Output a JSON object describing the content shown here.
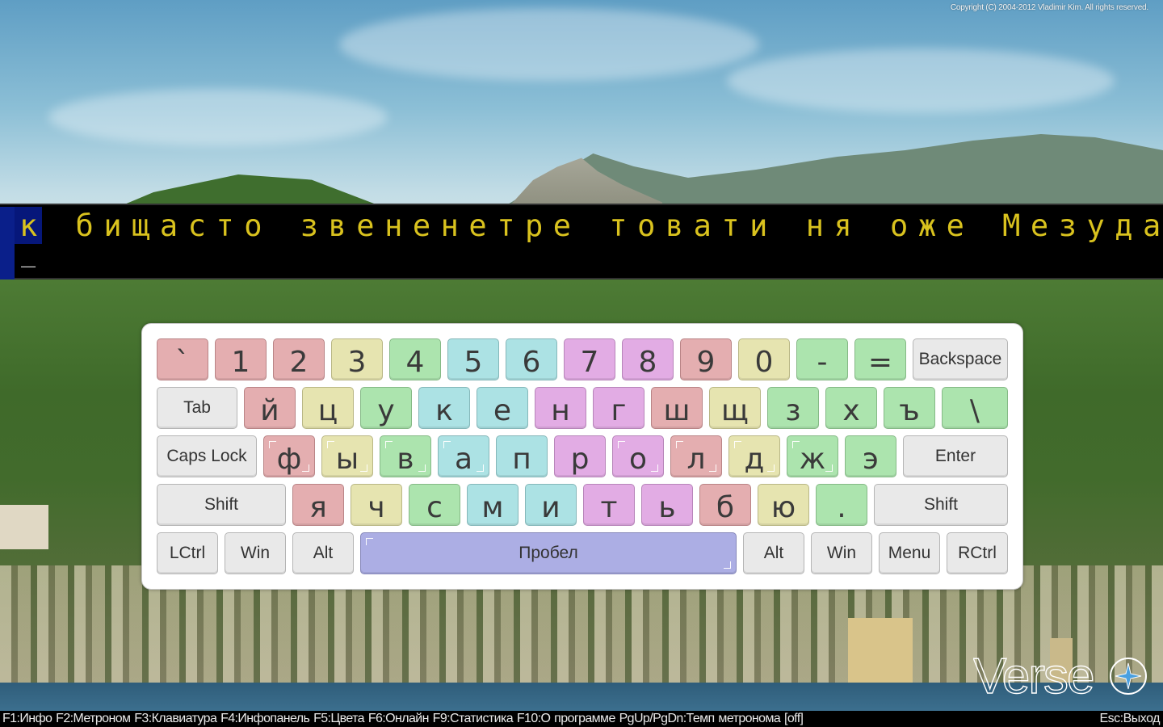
{
  "copyright": "Copyright (C) 2004-2012 Vladimir Kim. All rights reserved.",
  "typing": {
    "target_text": "к бищасто звененетре товати ня оже Мезуда",
    "current_char": "к",
    "input_text": "_"
  },
  "keyboard": {
    "rows": [
      [
        {
          "label": "`",
          "color": "pink"
        },
        {
          "label": "1",
          "color": "pink"
        },
        {
          "label": "2",
          "color": "pink"
        },
        {
          "label": "3",
          "color": "yellow"
        },
        {
          "label": "4",
          "color": "green"
        },
        {
          "label": "5",
          "color": "cyan"
        },
        {
          "label": "6",
          "color": "cyan"
        },
        {
          "label": "7",
          "color": "violet"
        },
        {
          "label": "8",
          "color": "violet"
        },
        {
          "label": "9",
          "color": "pink"
        },
        {
          "label": "0",
          "color": "yellow"
        },
        {
          "label": "-",
          "color": "green"
        },
        {
          "label": "=",
          "color": "green"
        },
        {
          "label": "Backspace",
          "color": "gray"
        }
      ],
      [
        {
          "label": "Tab",
          "color": "gray"
        },
        {
          "label": "й",
          "color": "pink"
        },
        {
          "label": "ц",
          "color": "yellow"
        },
        {
          "label": "у",
          "color": "green"
        },
        {
          "label": "к",
          "color": "cyan"
        },
        {
          "label": "е",
          "color": "cyan"
        },
        {
          "label": "н",
          "color": "violet"
        },
        {
          "label": "г",
          "color": "violet"
        },
        {
          "label": "ш",
          "color": "pink"
        },
        {
          "label": "щ",
          "color": "yellow"
        },
        {
          "label": "з",
          "color": "green"
        },
        {
          "label": "х",
          "color": "green"
        },
        {
          "label": "ъ",
          "color": "green"
        },
        {
          "label": "\\",
          "color": "green"
        }
      ],
      [
        {
          "label": "Caps Lock",
          "color": "gray"
        },
        {
          "label": "ф",
          "color": "pink"
        },
        {
          "label": "ы",
          "color": "yellow"
        },
        {
          "label": "в",
          "color": "green"
        },
        {
          "label": "а",
          "color": "cyan"
        },
        {
          "label": "п",
          "color": "cyan"
        },
        {
          "label": "р",
          "color": "violet"
        },
        {
          "label": "о",
          "color": "violet"
        },
        {
          "label": "л",
          "color": "pink"
        },
        {
          "label": "д",
          "color": "yellow"
        },
        {
          "label": "ж",
          "color": "green"
        },
        {
          "label": "э",
          "color": "green"
        },
        {
          "label": "Enter",
          "color": "gray"
        }
      ],
      [
        {
          "label": "Shift",
          "color": "gray"
        },
        {
          "label": "я",
          "color": "pink"
        },
        {
          "label": "ч",
          "color": "yellow"
        },
        {
          "label": "с",
          "color": "green"
        },
        {
          "label": "м",
          "color": "cyan"
        },
        {
          "label": "и",
          "color": "cyan"
        },
        {
          "label": "т",
          "color": "violet"
        },
        {
          "label": "ь",
          "color": "violet"
        },
        {
          "label": "б",
          "color": "pink"
        },
        {
          "label": "ю",
          "color": "yellow"
        },
        {
          "label": ".",
          "color": "green"
        },
        {
          "label": "Shift",
          "color": "gray"
        }
      ],
      [
        {
          "label": "LCtrl",
          "color": "gray"
        },
        {
          "label": "Win",
          "color": "gray"
        },
        {
          "label": "Alt",
          "color": "gray"
        },
        {
          "label": "Пробел",
          "color": "space"
        },
        {
          "label": "Alt",
          "color": "gray"
        },
        {
          "label": "Win",
          "color": "gray"
        },
        {
          "label": "Menu",
          "color": "gray"
        },
        {
          "label": "RCtrl",
          "color": "gray"
        }
      ]
    ]
  },
  "logo": {
    "text": "Verse",
    "icon": "compass-star-icon"
  },
  "status_bar": {
    "shortcuts": "F1:Инфо  F2:Метроном  F3:Клавиатура  F4:Инфопанель  F5:Цвета  F6:Онлайн  F9:Статистика  F10:О программе  PgUp/PgDn:Темп метронома [off]",
    "exit": "Esc:Выход"
  }
}
